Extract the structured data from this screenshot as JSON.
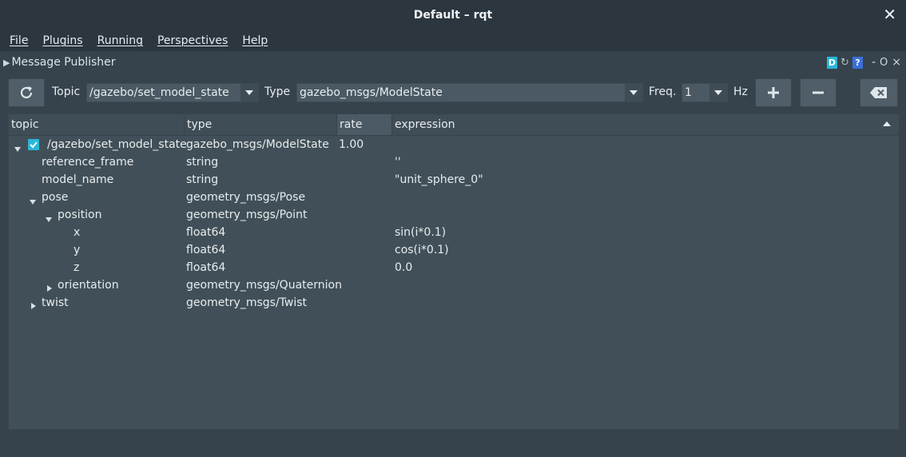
{
  "window": {
    "title": "Default – rqt"
  },
  "menu": [
    "File",
    "Plugins",
    "Running",
    "Perspectives",
    "Help"
  ],
  "dock": {
    "title": "Message Publisher",
    "tool_d": "D",
    "tool_q": "?",
    "tool_min": "-",
    "tool_float": "O",
    "tool_close": "×"
  },
  "toolbar": {
    "topic_label": "Topic",
    "topic_value": "/gazebo/set_model_state",
    "type_label": "Type",
    "type_value": "gazebo_msgs/ModelState",
    "freq_label": "Freq.",
    "freq_value": "1",
    "hz_label": "Hz"
  },
  "columns": [
    "topic",
    "type",
    "rate",
    "expression"
  ],
  "rows": [
    {
      "topic": "/gazebo/set_model_state",
      "type": "gazebo_msgs/ModelState",
      "rate": "1.00",
      "expression": ""
    },
    {
      "topic": "reference_frame",
      "type": "string",
      "rate": "",
      "expression": "''"
    },
    {
      "topic": "model_name",
      "type": "string",
      "rate": "",
      "expression": "\"unit_sphere_0\""
    },
    {
      "topic": "pose",
      "type": "geometry_msgs/Pose",
      "rate": "",
      "expression": ""
    },
    {
      "topic": "position",
      "type": "geometry_msgs/Point",
      "rate": "",
      "expression": ""
    },
    {
      "topic": "x",
      "type": "float64",
      "rate": "",
      "expression": "sin(i*0.1)"
    },
    {
      "topic": "y",
      "type": "float64",
      "rate": "",
      "expression": "cos(i*0.1)"
    },
    {
      "topic": "z",
      "type": "float64",
      "rate": "",
      "expression": "0.0"
    },
    {
      "topic": "orientation",
      "type": "geometry_msgs/Quaternion",
      "rate": "",
      "expression": ""
    },
    {
      "topic": "twist",
      "type": "geometry_msgs/Twist",
      "rate": "",
      "expression": ""
    }
  ],
  "colors": {
    "accent": "#29b6d8",
    "background": "#36434c",
    "panel": "#415058"
  }
}
